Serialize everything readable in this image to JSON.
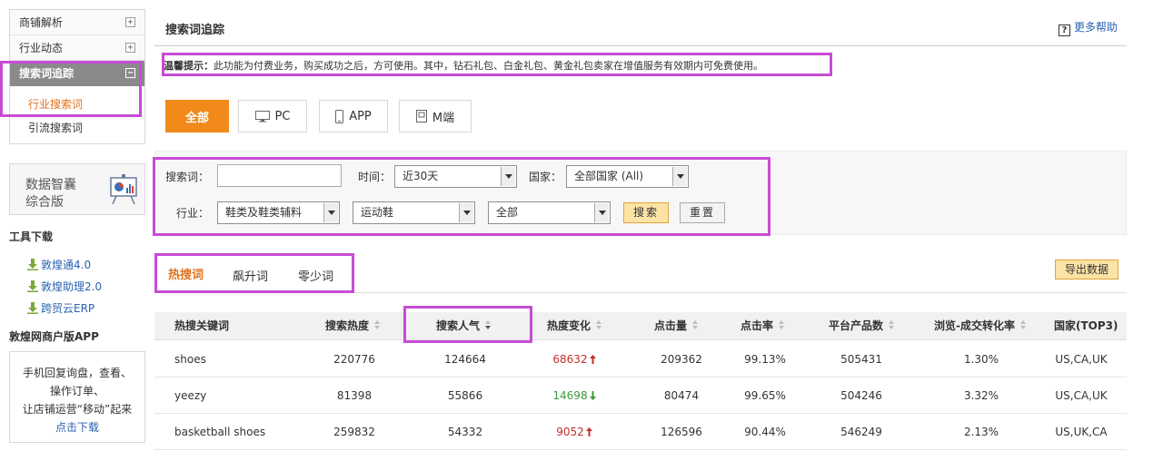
{
  "sidebar": {
    "menu": [
      {
        "label": "商铺解析",
        "toggle": "+"
      },
      {
        "label": "行业动态",
        "toggle": "+"
      },
      {
        "label": "搜索词追踪",
        "toggle": "−"
      }
    ],
    "sub_items": [
      "行业搜索词",
      "引流搜索词"
    ],
    "promo": {
      "line1": "数据智囊",
      "line2": "综合版"
    },
    "tools_title": "工具下载",
    "tools": [
      "敦煌通4.0",
      "敦煌助理2.0",
      "跨贸云ERP"
    ],
    "app_title": "敦煌网商户版APP",
    "app_lines": [
      "手机回复询盘，查看、",
      "操作订单、",
      "让店铺运营“移动”起来"
    ],
    "app_link": "点击下载"
  },
  "header": {
    "title": "搜索词追踪",
    "help": "更多帮助"
  },
  "notice": {
    "label": "温馨提示：",
    "text": "此功能为付费业务，购买成功之后，方可使用。其中，钻石礼包、白金礼包、黄金礼包卖家在增值服务有效期内可免费使用。"
  },
  "platforms": [
    "全部",
    "PC",
    "APP",
    "M端"
  ],
  "filters": {
    "keyword_label": "搜索词：",
    "keyword_value": "",
    "time_label": "时间：",
    "time_value": "近30天",
    "country_label": "国家：",
    "country_value": "全部国家 (All)",
    "industry_label": "行业：",
    "industry_l1": "鞋类及鞋类辅料",
    "industry_l2": "运动鞋",
    "industry_l3": "全部",
    "search_btn": "搜索",
    "reset_btn": "重置"
  },
  "tabs": [
    "热搜词",
    "飙升词",
    "零少词"
  ],
  "export_btn": "导出数据",
  "table": {
    "columns": [
      "热搜关键词",
      "搜索热度",
      "搜索人气",
      "热度变化",
      "点击量",
      "点击率",
      "平台产品数",
      "浏览-成交转化率",
      "国家(TOP3)"
    ],
    "rows": [
      {
        "keyword": "shoes",
        "heat": "220776",
        "popularity": "124664",
        "change": "68632",
        "dir": "up",
        "clicks": "209362",
        "ctr": "99.13%",
        "products": "505431",
        "conv": "1.30%",
        "country": "US,CA,UK"
      },
      {
        "keyword": "yeezy",
        "heat": "81398",
        "popularity": "55866",
        "change": "14698",
        "dir": "down",
        "clicks": "80474",
        "ctr": "99.65%",
        "products": "504246",
        "conv": "3.32%",
        "country": "US,CA,UK"
      },
      {
        "keyword": "basketball shoes",
        "heat": "259832",
        "popularity": "54332",
        "change": "9052",
        "dir": "up",
        "clicks": "126596",
        "ctr": "90.44%",
        "products": "546249",
        "conv": "2.13%",
        "country": "US,UK,CA"
      }
    ]
  },
  "colors": {
    "accent": "#f28a1b",
    "highlight": "#c84bd6",
    "link": "#2b63b0",
    "up": "#c0302b",
    "down": "#3a9a3a"
  }
}
